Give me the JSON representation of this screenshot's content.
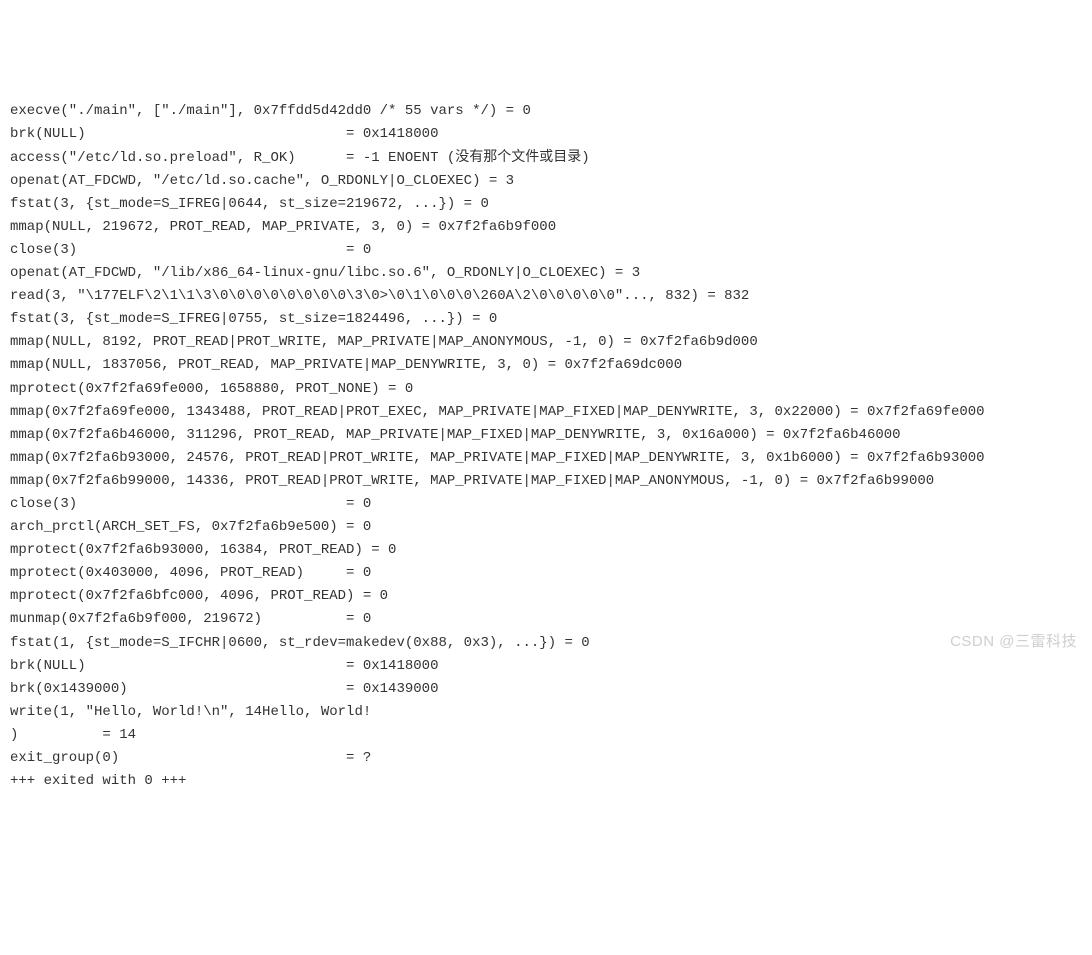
{
  "strace": {
    "lines": [
      "execve(\"./main\", [\"./main\"], 0x7ffdd5d42dd0 /* 55 vars */) = 0",
      "brk(NULL)                               = 0x1418000",
      "access(\"/etc/ld.so.preload\", R_OK)      = -1 ENOENT (没有那个文件或目录)",
      "openat(AT_FDCWD, \"/etc/ld.so.cache\", O_RDONLY|O_CLOEXEC) = 3",
      "fstat(3, {st_mode=S_IFREG|0644, st_size=219672, ...}) = 0",
      "mmap(NULL, 219672, PROT_READ, MAP_PRIVATE, 3, 0) = 0x7f2fa6b9f000",
      "close(3)                                = 0",
      "openat(AT_FDCWD, \"/lib/x86_64-linux-gnu/libc.so.6\", O_RDONLY|O_CLOEXEC) = 3",
      "read(3, \"\\177ELF\\2\\1\\1\\3\\0\\0\\0\\0\\0\\0\\0\\0\\3\\0>\\0\\1\\0\\0\\0\\260A\\2\\0\\0\\0\\0\\0\"..., 832) = 832",
      "fstat(3, {st_mode=S_IFREG|0755, st_size=1824496, ...}) = 0",
      "mmap(NULL, 8192, PROT_READ|PROT_WRITE, MAP_PRIVATE|MAP_ANONYMOUS, -1, 0) = 0x7f2fa6b9d000",
      "mmap(NULL, 1837056, PROT_READ, MAP_PRIVATE|MAP_DENYWRITE, 3, 0) = 0x7f2fa69dc000",
      "mprotect(0x7f2fa69fe000, 1658880, PROT_NONE) = 0",
      "mmap(0x7f2fa69fe000, 1343488, PROT_READ|PROT_EXEC, MAP_PRIVATE|MAP_FIXED|MAP_DENYWRITE, 3, 0x22000) = 0x7f2fa69fe000",
      "mmap(0x7f2fa6b46000, 311296, PROT_READ, MAP_PRIVATE|MAP_FIXED|MAP_DENYWRITE, 3, 0x16a000) = 0x7f2fa6b46000",
      "mmap(0x7f2fa6b93000, 24576, PROT_READ|PROT_WRITE, MAP_PRIVATE|MAP_FIXED|MAP_DENYWRITE, 3, 0x1b6000) = 0x7f2fa6b93000",
      "mmap(0x7f2fa6b99000, 14336, PROT_READ|PROT_WRITE, MAP_PRIVATE|MAP_FIXED|MAP_ANONYMOUS, -1, 0) = 0x7f2fa6b99000",
      "close(3)                                = 0",
      "arch_prctl(ARCH_SET_FS, 0x7f2fa6b9e500) = 0",
      "mprotect(0x7f2fa6b93000, 16384, PROT_READ) = 0",
      "mprotect(0x403000, 4096, PROT_READ)     = 0",
      "mprotect(0x7f2fa6bfc000, 4096, PROT_READ) = 0",
      "munmap(0x7f2fa6b9f000, 219672)          = 0",
      "fstat(1, {st_mode=S_IFCHR|0600, st_rdev=makedev(0x88, 0x3), ...}) = 0",
      "brk(NULL)                               = 0x1418000",
      "brk(0x1439000)                          = 0x1439000",
      "write(1, \"Hello, World!\\n\", 14Hello, World!",
      ")          = 14",
      "exit_group(0)                           = ?",
      "+++ exited with 0 +++"
    ]
  },
  "watermark": "CSDN @三雷科技"
}
